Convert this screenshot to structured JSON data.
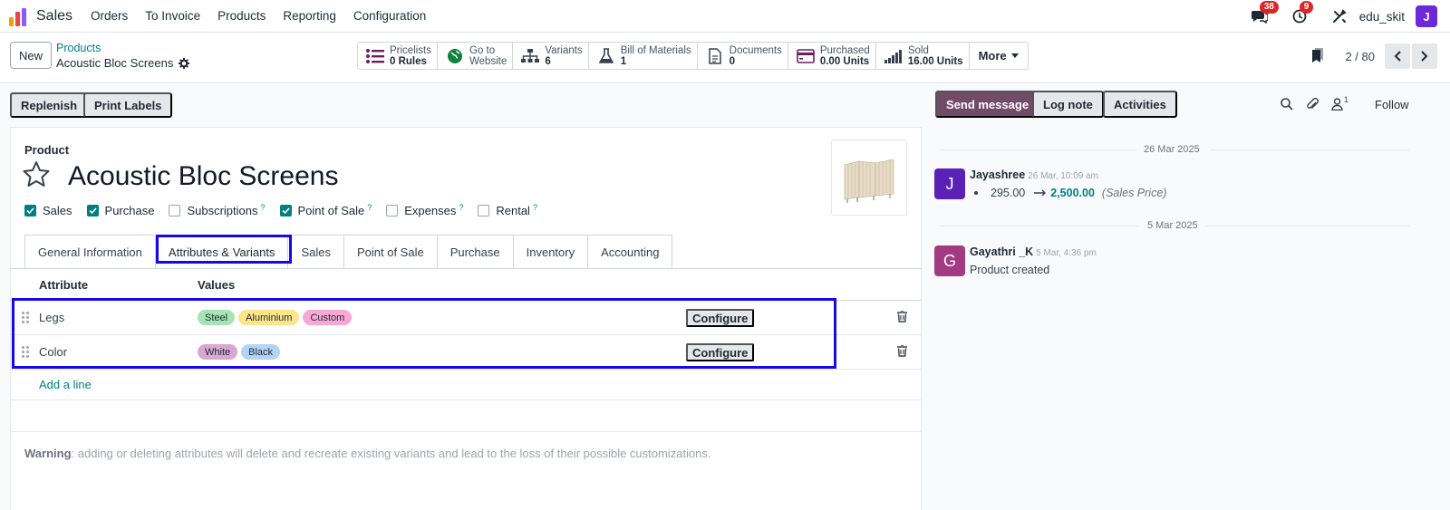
{
  "app": {
    "name": "Sales"
  },
  "menu": [
    "Orders",
    "To Invoice",
    "Products",
    "Reporting",
    "Configuration"
  ],
  "topbar": {
    "messages_count": "38",
    "activities_count": "9",
    "company": "edu_skit",
    "user_initial": "J"
  },
  "breadcrumb": {
    "new_label": "New",
    "parent": "Products",
    "current": "Acoustic Bloc Screens"
  },
  "smart_buttons": [
    {
      "icon": "list-icon",
      "line1": "Pricelists",
      "line2": "0 Rules"
    },
    {
      "icon": "globe-icon",
      "line1": "Go to",
      "line2": "Website"
    },
    {
      "icon": "sitemap-icon",
      "line1": "Variants",
      "line2": "6"
    },
    {
      "icon": "flask-icon",
      "line1": "Bill of Materials",
      "line2": "1"
    },
    {
      "icon": "document-icon",
      "line1": "Documents",
      "line2": "0"
    },
    {
      "icon": "credit-card-icon",
      "line1": "Purchased",
      "line2": "0.00 Units"
    },
    {
      "icon": "signal-icon",
      "line1": "Sold",
      "line2": "16.00 Units"
    }
  ],
  "more_label": "More",
  "pager": {
    "value": "2 / 80"
  },
  "actions": {
    "replenish": "Replenish",
    "print_labels": "Print Labels"
  },
  "product": {
    "label": "Product",
    "name": "Acoustic Bloc Screens",
    "checkboxes": [
      {
        "label": "Sales",
        "checked": true,
        "help": false
      },
      {
        "label": "Purchase",
        "checked": true,
        "help": false
      },
      {
        "label": "Subscriptions",
        "checked": false,
        "help": true
      },
      {
        "label": "Point of Sale",
        "checked": true,
        "help": true
      },
      {
        "label": "Expenses",
        "checked": false,
        "help": true
      },
      {
        "label": "Rental",
        "checked": false,
        "help": true
      }
    ],
    "help_mark": "?"
  },
  "tabs": [
    "General Information",
    "Attributes & Variants",
    "Sales",
    "Point of Sale",
    "Purchase",
    "Inventory",
    "Accounting"
  ],
  "attributes": {
    "col_attribute": "Attribute",
    "col_values": "Values",
    "rows": [
      {
        "name": "Legs",
        "values": [
          {
            "label": "Steel",
            "color": "#a7e3b3"
          },
          {
            "label": "Aluminium",
            "color": "#fde68a"
          },
          {
            "label": "Custom",
            "color": "#f9a8d4"
          }
        ]
      },
      {
        "name": "Color",
        "values": [
          {
            "label": "White",
            "color": "#d8a8d0"
          },
          {
            "label": "Black",
            "color": "#b3d4f5"
          }
        ]
      }
    ],
    "configure_label": "Configure",
    "add_line": "Add a line",
    "warning_bold": "Warning",
    "warning_text": ": adding or deleting attributes will delete and recreate existing variants and lead to the loss of their possible customizations."
  },
  "chatter": {
    "send_message": "Send message",
    "log_note": "Log note",
    "activities": "Activities",
    "followers_count": "1",
    "follow": "Follow",
    "date1": "26 Mar 2025",
    "msg1": {
      "initial": "J",
      "author": "Jayashree",
      "time": "26 Mar, 10:09 am",
      "old_value": "295.00",
      "new_value": "2,500.00",
      "field": "(Sales Price)",
      "avatar_color": "#5b21b6"
    },
    "date2": "5 Mar 2025",
    "msg2": {
      "initial": "G",
      "author": "Gayathri _K",
      "time": "5 Mar, 4:36 pm",
      "body": "Product created",
      "avatar_color": "#a33b83"
    }
  },
  "colors": {
    "accent": "#017e84",
    "primary": "#714b67",
    "highlight": "#1808e8"
  }
}
